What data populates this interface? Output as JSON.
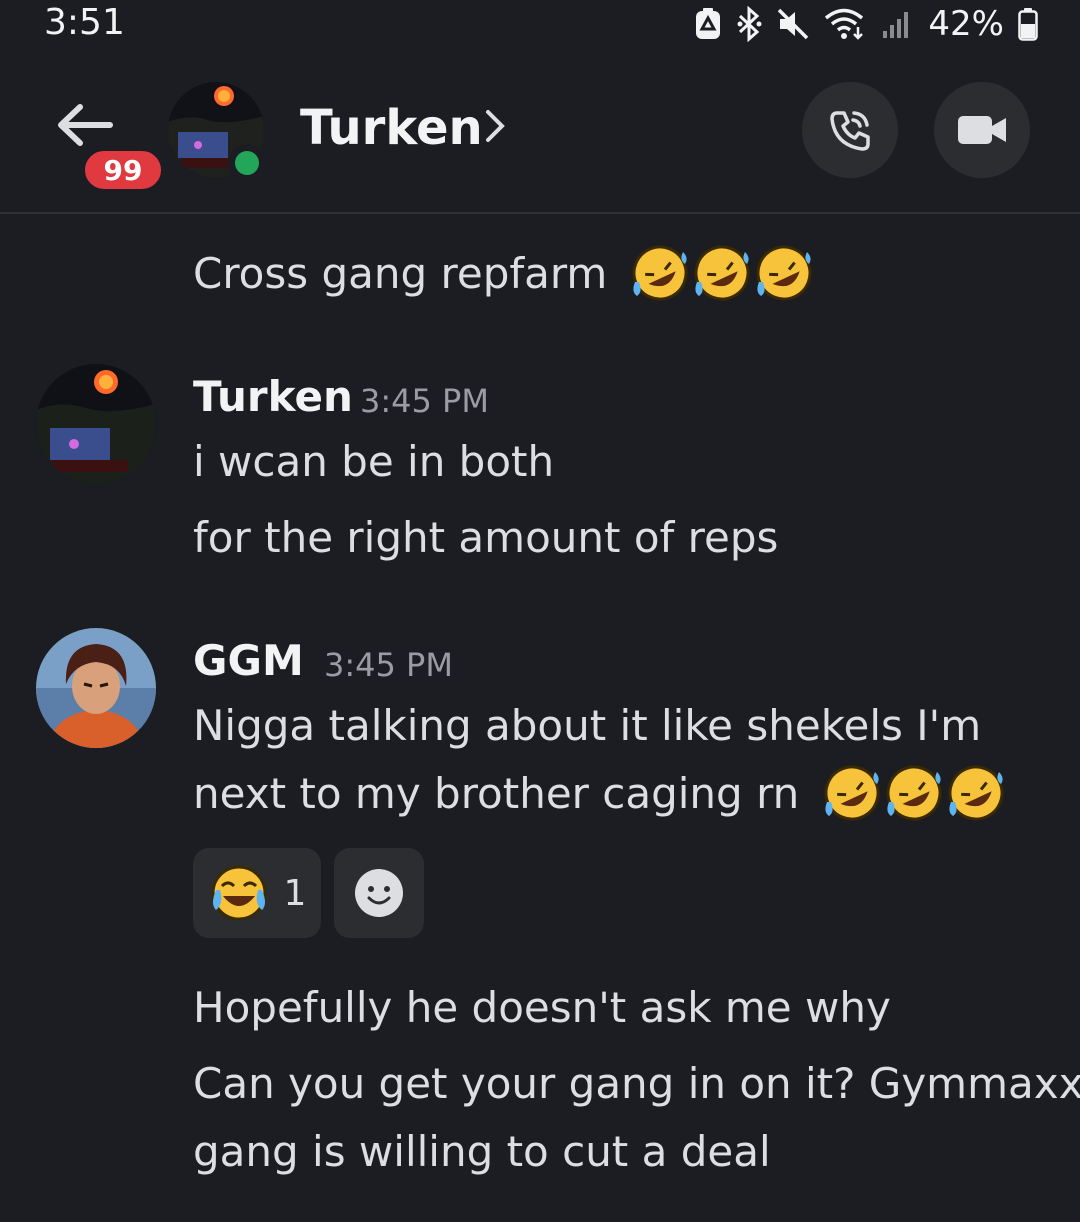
{
  "status_bar": {
    "time": "3:51",
    "battery": "42%"
  },
  "header": {
    "unread_badge": "99",
    "title": "Turken",
    "online_color": "#23a55a"
  },
  "messages": [
    {
      "text": "Cross gang repfarm",
      "emojis": [
        "rofl",
        "rofl",
        "rofl"
      ]
    },
    {
      "author": "Turken",
      "time": "3:45 PM",
      "lines": [
        "i wcan be in both",
        "for the right amount of reps"
      ]
    },
    {
      "author": "GGM",
      "time": "3:45 PM",
      "lines": [
        "Nigga talking about it like shekels I'm",
        "next to my brother caging rn"
      ],
      "emojis": [
        "rofl",
        "rofl",
        "rofl"
      ],
      "reaction": {
        "emoji": "joy",
        "count": "1"
      }
    },
    {
      "text": "Hopefully he doesn't ask me why"
    },
    {
      "lines": [
        "Can you get your gang in on it? Gymmaxx",
        "gang is willing to cut a deal"
      ]
    }
  ],
  "colors": {
    "background": "#1c1d22",
    "surface": "#2b2d31",
    "badge": "#e0393f"
  }
}
